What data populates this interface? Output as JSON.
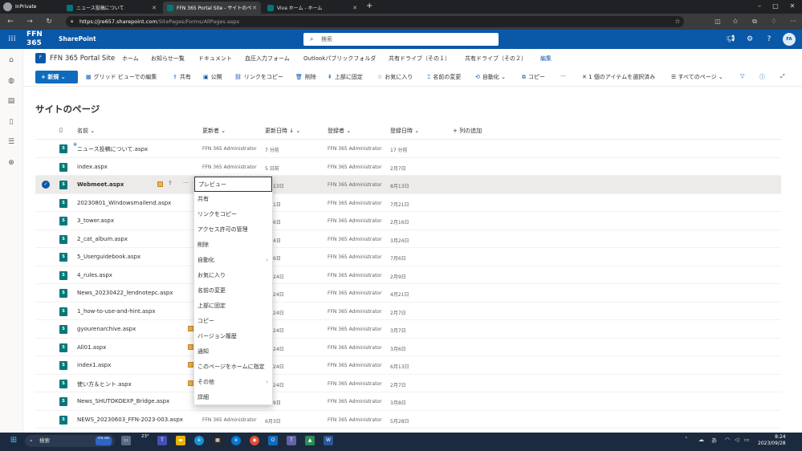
{
  "browser": {
    "inprivate_label": "InPrivate",
    "tabs": [
      {
        "label": "ニュース投稿について",
        "favicon_color": "#03787c",
        "active": false
      },
      {
        "label": "FFN 365 Portal Site - サイトのペ",
        "favicon_color": "#03787c",
        "active": true
      },
      {
        "label": "Viva ホーム - ホーム",
        "favicon_color": "#03787c",
        "active": false
      }
    ],
    "url_host": "https://jre657.sharepoint.com",
    "url_path": "/SitePages/Forms/AllPages.aspx"
  },
  "suitebar": {
    "brand": "FFN 365",
    "app_name": "SharePoint",
    "search_placeholder": "検索",
    "avatar_initials": "FA"
  },
  "site": {
    "logo_letter": "F",
    "title": "FFN 365 Portal Site",
    "nav": [
      "ホーム",
      "お知らせ一覧",
      "ドキュメント",
      "血圧入力フォーム",
      "Outlookパブリックフォルダ",
      "共有ドライブ（その１）",
      "共有ドライブ（その２）"
    ],
    "edit_label": "編集"
  },
  "commandbar": {
    "new_label": "新規",
    "grid_view": "グリッド ビューでの編集",
    "share": "共有",
    "publish": "公開",
    "copy_link": "リンクをコピー",
    "delete": "削除",
    "pin_top": "上部に固定",
    "favorite": "お気に入り",
    "rename": "名前の変更",
    "automate": "自動化",
    "copy": "コピー",
    "more": "···",
    "selected_count": "1 個のアイテムを選択済み",
    "view_name": "すべてのページ"
  },
  "page": {
    "title": "サイトのページ",
    "columns": {
      "name": "名前",
      "modified_by": "更新者",
      "modified": "更新日時",
      "created_by": "登録者",
      "created": "登録日時",
      "add_column": "列の追加"
    },
    "rows": [
      {
        "name": "ニュース投稿について.aspx",
        "modified_by": "FFN 365 Administrator",
        "modified": "7 分前",
        "created_by": "FFN 365 Administrator",
        "created": "17 分前"
      },
      {
        "name": "index.aspx",
        "modified_by": "FFN 365 Administrator",
        "modified": "5 日前",
        "created_by": "FFN 365 Administrator",
        "created": "2月7日"
      },
      {
        "name": "Webmeet.aspx",
        "modified_by": "",
        "modified": "13日",
        "created_by": "FFN 365 Administrator",
        "created": "8月13日"
      },
      {
        "name": "20230801_Windowsmailend.aspx",
        "modified_by": "",
        "modified": "1日",
        "created_by": "FFN 365 Administrator",
        "created": "7月21日"
      },
      {
        "name": "3_tower.aspx",
        "modified_by": "",
        "modified": "6日",
        "created_by": "FFN 365 Administrator",
        "created": "2月16日"
      },
      {
        "name": "2_cat_album.aspx",
        "modified_by": "",
        "modified": "4日",
        "created_by": "FFN 365 Administrator",
        "created": "3月24日"
      },
      {
        "name": "5_Userguidebook.aspx",
        "modified_by": "",
        "modified": "6日",
        "created_by": "FFN 365 Administrator",
        "created": "7月6日"
      },
      {
        "name": "4_rules.aspx",
        "modified_by": "",
        "modified": "24日",
        "created_by": "FFN 365 Administrator",
        "created": "2月9日"
      },
      {
        "name": "News_20230422_lendnotepc.aspx",
        "modified_by": "",
        "modified": "24日",
        "created_by": "FFN 365 Administrator",
        "created": "4月21日"
      },
      {
        "name": "1_how-to-use-and-hint.aspx",
        "modified_by": "",
        "modified": "24日",
        "created_by": "FFN 365 Administrator",
        "created": "2月7日"
      },
      {
        "name": "gyourenarchive.aspx",
        "modified_by": "",
        "modified": "24日",
        "created_by": "FFN 365 Administrator",
        "created": "3月7日"
      },
      {
        "name": "All01.aspx",
        "modified_by": "",
        "modified": "24日",
        "created_by": "FFN 365 Administrator",
        "created": "3月6日"
      },
      {
        "name": "index1.aspx",
        "modified_by": "",
        "modified": "24日",
        "created_by": "FFN 365 Administrator",
        "created": "6月13日"
      },
      {
        "name": "使い方＆ヒント.aspx",
        "modified_by": "",
        "modified": "24日",
        "created_by": "FFN 365 Administrator",
        "created": "2月7日"
      },
      {
        "name": "News_SHUTOKOEXP_Bridge.aspx",
        "modified_by": "",
        "modified": "9日",
        "created_by": "FFN 365 Administrator",
        "created": "3月8日"
      },
      {
        "name": "NEWS_20230603_FFN-2023-003.aspx",
        "modified_by": "FFN 365 Administrator",
        "modified": "6月3日",
        "created_by": "FFN 365 Administrator",
        "created": "5月28日"
      }
    ]
  },
  "context_menu": [
    {
      "label": "プレビュー"
    },
    {
      "label": "共有"
    },
    {
      "label": "リンクをコピー"
    },
    {
      "label": "アクセス許可の管理"
    },
    {
      "label": "削除"
    },
    {
      "label": "自動化",
      "submenu": true
    },
    {
      "label": "お気に入り"
    },
    {
      "label": "名前の変更"
    },
    {
      "label": "上部に固定"
    },
    {
      "label": "コピー"
    },
    {
      "label": "バージョン履歴"
    },
    {
      "label": "通知"
    },
    {
      "label": "このページをホームに指定"
    },
    {
      "label": "その他",
      "submenu": true
    },
    {
      "label": "詳細"
    }
  ],
  "taskbar": {
    "search_label": "検索",
    "search_pill": "FFN 365",
    "temperature": "23°",
    "ime": "あ",
    "time": "8:24",
    "date": "2023/09/28"
  },
  "colors": {
    "suitebar": "#0a58a8",
    "accent": "#0f6cbd",
    "selected_row": "#edebe9",
    "taskbar": "#1b2a3e"
  }
}
